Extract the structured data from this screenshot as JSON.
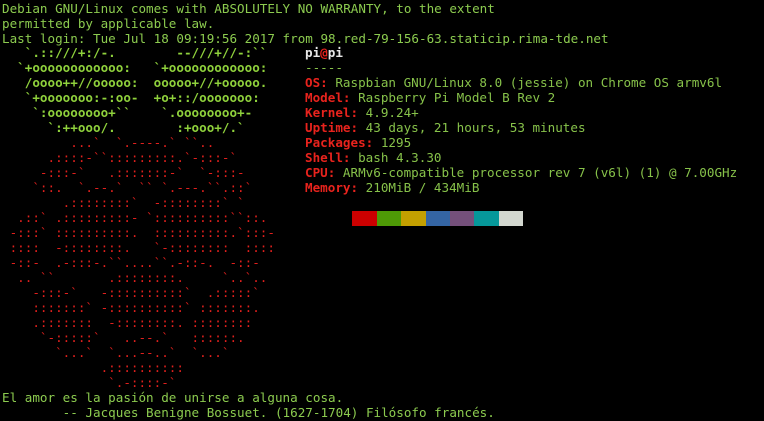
{
  "header": {
    "line1": "Debian GNU/Linux comes with ABSOLUTELY NO WARRANTY, to the extent",
    "line2": "permitted by applicable law.",
    "line3": "Last login: Tue Jul 18 09:19:56 2017 from 98.red-79-156-63.staticip.rima-tde.net"
  },
  "logo": {
    "leaves": [
      "   `.::///+:/-.        --///+//-:``",
      "  `+oooooooooooo:   `+oooooooooooo:",
      "   /oooo++//ooooo:  ooooo+//+ooooo.",
      "   `+ooooooo:-:oo-  +o+::/ooooooo:",
      "    `:oooooooo+``    `.oooooooo+-",
      "      `:++ooo/.        :+ooo+/.`"
    ],
    "berry": [
      "         ...`  `.----.` ``..",
      "      .::::-``:::::::::.`-:::-`",
      "     -:::-`   .:::::::-`  `-:::-",
      "    `::.  `.--.`  `` `.---.``.::`",
      "        .::::::::`  -::::::::` `",
      "  .::` .:::::::::- `::::::::::``::.",
      " -:::` ::::::::::.  ::::::::::.`:::-",
      " ::::  -::::::::.   `-::::::::  ::::",
      " -::-  .-:::-.``....``.-::-.  -::-",
      "  .. ``       .::::::::.     `..`..",
      "    -:::-`   -::::::::::`  .:::::`",
      "    :::::::` -::::::::::` :::::::.",
      "    .:::::::  -::::::::. ::::::::",
      "     `-:::::`   ..--.`   ::::::.",
      "       `...`  `...--..`  `...`",
      "             .::::::::::",
      "              `.-::::-`"
    ]
  },
  "sysinfo": {
    "user": "pi",
    "at": "@",
    "host": "pi",
    "separator": "-----",
    "fields": [
      {
        "label": "OS",
        "value": "Raspbian GNU/Linux 8.0 (jessie) on Chrome OS armv6l"
      },
      {
        "label": "Model",
        "value": "Raspberry Pi Model B Rev 2"
      },
      {
        "label": "Kernel",
        "value": "4.9.24+"
      },
      {
        "label": "Uptime",
        "value": "43 days, 21 hours, 53 minutes"
      },
      {
        "label": "Packages",
        "value": "1295"
      },
      {
        "label": "Shell",
        "value": "bash 4.3.30"
      },
      {
        "label": "CPU",
        "value": "ARMv6-compatible processor rev 7 (v6l) (1) @ 7.00GHz"
      },
      {
        "label": "Memory",
        "value": "210MiB / 434MiB"
      }
    ],
    "palette": [
      "#000000",
      "#cc0000",
      "#4e9a06",
      "#c4a000",
      "#3465a4",
      "#75507b",
      "#06989a",
      "#d3d7cf"
    ]
  },
  "quote": {
    "text": "El amor es la pasión de unirse a alguna cosa.",
    "author": "        -- Jacques Benigne Bossuet. (1627-1704) Filósofo francés."
  }
}
